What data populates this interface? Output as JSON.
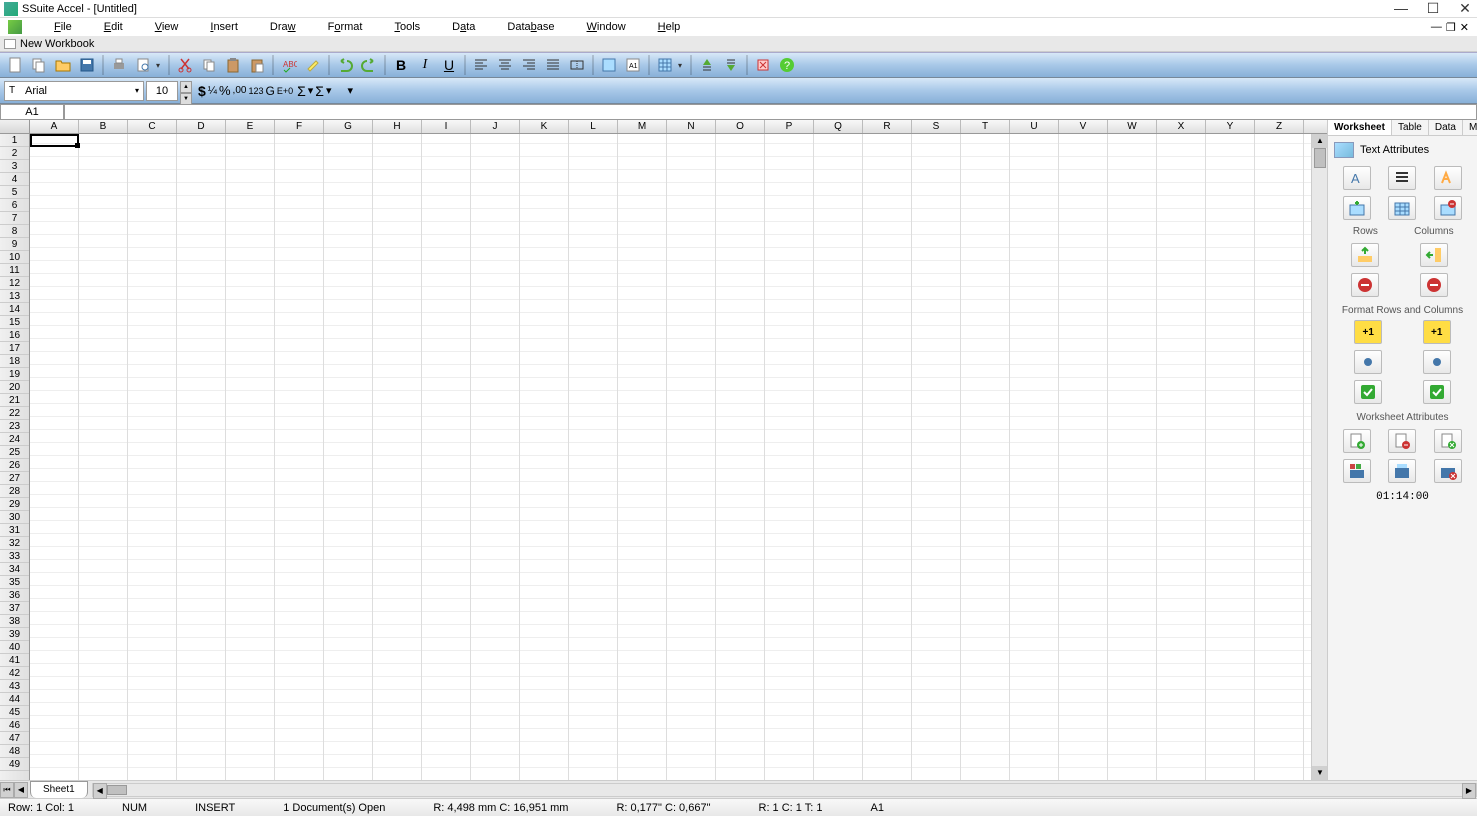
{
  "titlebar": {
    "title": "SSuite Accel - [Untitled]"
  },
  "menus": [
    "File",
    "Edit",
    "View",
    "Insert",
    "Draw",
    "Format",
    "Tools",
    "Data",
    "Database",
    "Window",
    "Help"
  ],
  "tab": {
    "name": "New Workbook"
  },
  "font": {
    "name": "Arial",
    "size": "10"
  },
  "cellref": "A1",
  "columns": [
    "A",
    "B",
    "C",
    "D",
    "E",
    "F",
    "G",
    "H",
    "I",
    "J",
    "K",
    "L",
    "M",
    "N",
    "O",
    "P",
    "Q",
    "R",
    "S",
    "T",
    "U",
    "V",
    "W",
    "X",
    "Y",
    "Z"
  ],
  "rowcount": 49,
  "side": {
    "tabs": [
      "Worksheet",
      "Table",
      "Data",
      "Map"
    ],
    "active": 0,
    "section1": "Text Attributes",
    "rows_lbl": "Rows",
    "cols_lbl": "Columns",
    "section2": "Format Rows and Columns",
    "section3": "Worksheet Attributes",
    "time": "01:14:00"
  },
  "sheet": {
    "name": "Sheet1"
  },
  "status": {
    "rowcol": "Row:  1   Col:  1",
    "num": "NUM",
    "insert": "INSERT",
    "docs": "1 Document(s) Open",
    "mm": "R: 4,498 mm   C: 16,951 mm",
    "inch": "R: 0,177\"  C: 0,667\"",
    "rct": "R: 1  C: 1  T: 1",
    "cell": "A1"
  }
}
